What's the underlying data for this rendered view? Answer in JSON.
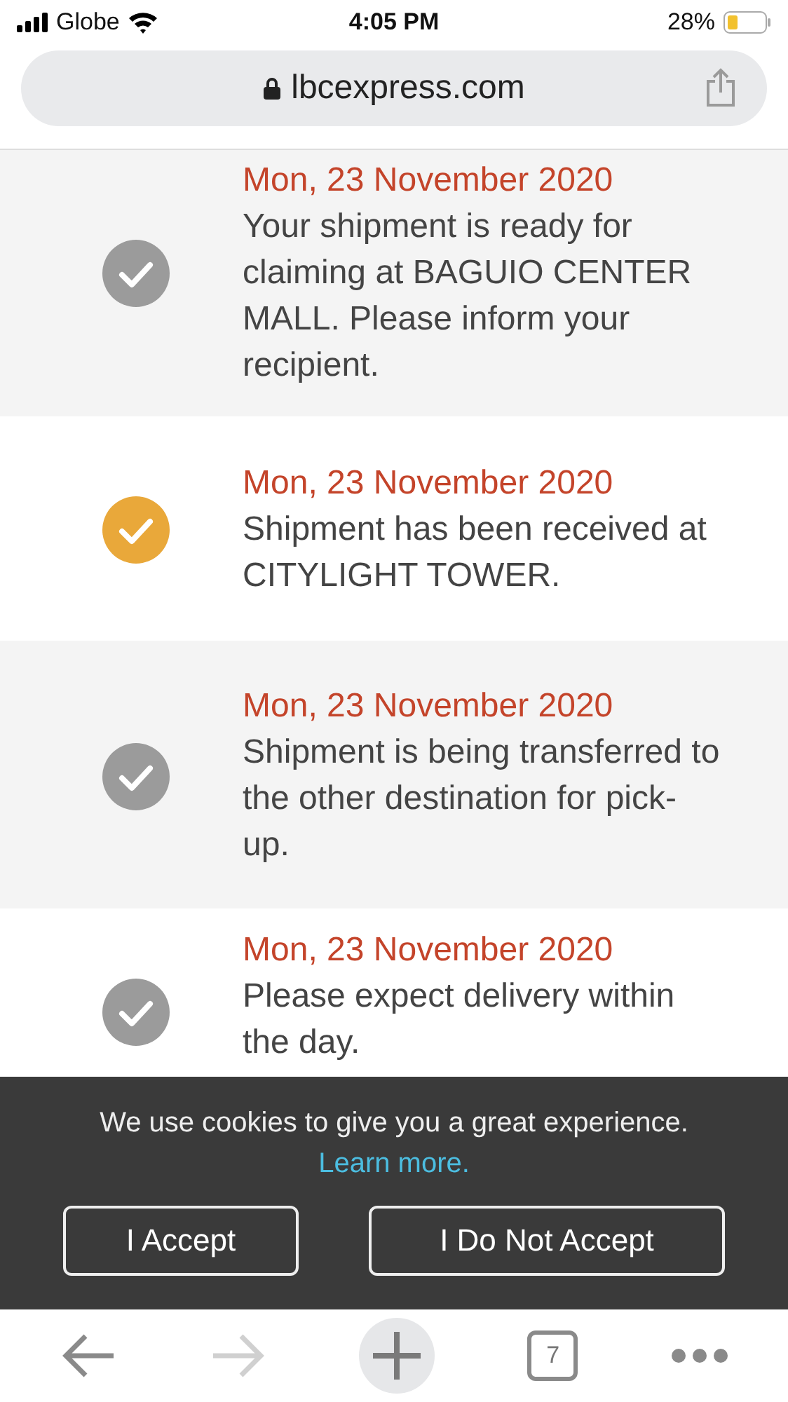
{
  "status_bar": {
    "carrier": "Globe",
    "time": "4:05 PM",
    "battery": "28%"
  },
  "address_bar": {
    "url": "lbcexpress.com"
  },
  "timeline": [
    {
      "date": "Mon, 23 November 2020",
      "text": "Your shipment is ready for claiming at BAGUIO CENTER MALL. Please inform your recipient.",
      "color": "#9b9b9b"
    },
    {
      "date": "Mon, 23 November 2020",
      "text": "Shipment has been received at CITYLIGHT TOWER.",
      "color": "#e9a83a"
    },
    {
      "date": "Mon, 23 November 2020",
      "text": "Shipment is being transferred to the other destination for pick-up.",
      "color": "#9b9b9b"
    },
    {
      "date": "Mon, 23 November 2020",
      "text": "Please expect delivery within the day.",
      "color": "#9b9b9b"
    }
  ],
  "cookie_banner": {
    "message": "We use cookies to give you a great experience.",
    "link": "Learn more.",
    "buttons": [
      "I Accept",
      "I Do Not Accept"
    ]
  },
  "toolbar": {
    "back_disabled": false,
    "forward_disabled": true,
    "tab_count": "7"
  }
}
